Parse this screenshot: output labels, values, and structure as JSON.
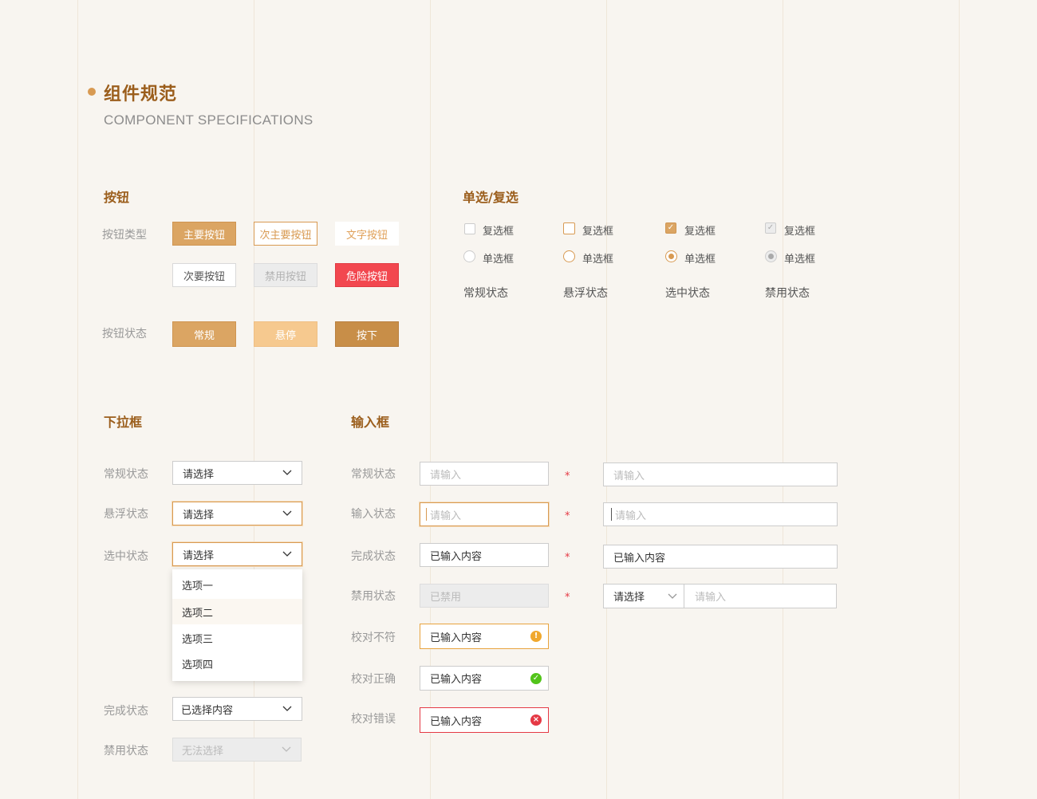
{
  "header": {
    "title": "组件规范",
    "subtitle": "COMPONENT SPECIFICATIONS"
  },
  "buttons": {
    "section_title": "按钮",
    "type_label": "按钮类型",
    "state_label": "按钮状态",
    "primary": "主要按钮",
    "secondary": "次主要按钮",
    "text": "文字按钮",
    "minor": "次要按钮",
    "disabled": "禁用按钮",
    "danger": "危险按钮",
    "normal": "常规",
    "hover": "悬停",
    "pressed": "按下"
  },
  "choice": {
    "section_title": "单选/复选",
    "checkbox_label": "复选框",
    "radio_label": "单选框",
    "states": [
      "常规状态",
      "悬浮状态",
      "选中状态",
      "禁用状态"
    ]
  },
  "dropdown": {
    "section_title": "下拉框",
    "normal_label": "常规状态",
    "hover_label": "悬浮状态",
    "selected_label": "选中状态",
    "done_label": "完成状态",
    "disabled_label": "禁用状态",
    "placeholder": "请选择",
    "done_value": "已选择内容",
    "disabled_value": "无法选择",
    "options": [
      "选项一",
      "选项二",
      "选项三",
      "选项四"
    ]
  },
  "input": {
    "section_title": "输入框",
    "normal_label": "常规状态",
    "typing_label": "输入状态",
    "done_label": "完成状态",
    "disabled_label": "禁用状态",
    "warn_label": "校对不符",
    "ok_label": "校对正确",
    "error_label": "校对错误",
    "placeholder": "请输入",
    "filled_value": "已输入内容",
    "disabled_value": "已禁用",
    "required_mark": "*",
    "combo_select": "请选择",
    "combo_placeholder": "请输入",
    "warn_icon": "!",
    "ok_icon": "✓",
    "error_icon": "×"
  },
  "colors": {
    "brand": "#d89a52",
    "title": "#9b5e1c",
    "danger": "#f2474f",
    "warning": "#f0a82e",
    "success": "#52c41a",
    "error": "#e53945"
  },
  "icons": {
    "checkmark": "check-icon",
    "chevron": "chevron-down-icon",
    "warning": "warning-icon",
    "success": "success-icon",
    "error": "error-icon"
  }
}
